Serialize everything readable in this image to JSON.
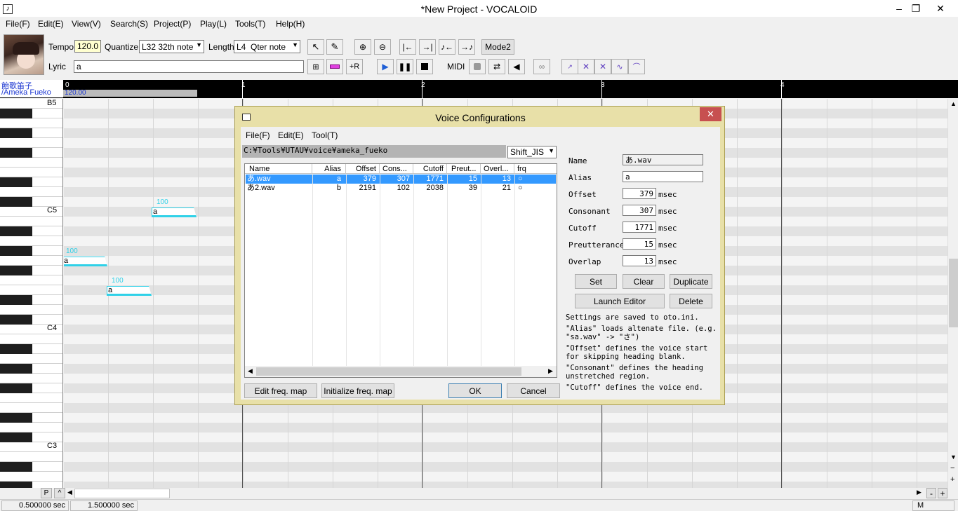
{
  "window": {
    "title": "*New Project - VOCALOID",
    "minimize": "–",
    "restore": "❐",
    "close": "✕"
  },
  "menu": [
    "File(F)",
    "Edit(E)",
    "View(V)",
    "Search(S)",
    "Project(P)",
    "Play(L)",
    "Tools(T)",
    "Help(H)"
  ],
  "toolbar": {
    "tempo_label": "Tempo",
    "tempo_value": "120.0",
    "quantize_label": "Quantize",
    "quantize_value": "L32 32th note",
    "length_label": "Length",
    "length_value": "L4  Qter note",
    "lyric_label": "Lyric",
    "lyric_value": "a",
    "mode_button": "Mode2",
    "midi_label": "MIDI",
    "icons": [
      "arrow-icon",
      "pencil-icon",
      "zoom-in-icon",
      "zoom-out-icon"
    ]
  },
  "track": {
    "singer_jp": "飴歌笛子",
    "singer_en": "/Ameka Fueko",
    "tempo_marker": "120.00"
  },
  "ruler": {
    "measures": [
      "0",
      "1",
      "2",
      "3",
      "4"
    ]
  },
  "piano": {
    "labels": [
      "B5",
      "C5",
      "C4",
      "C3"
    ]
  },
  "notes": [
    {
      "lyric": "a",
      "velocity": "100"
    },
    {
      "lyric": "a",
      "velocity": "100"
    },
    {
      "lyric": "a",
      "velocity": "100"
    }
  ],
  "bottom": {
    "p_button": "P",
    "caret": "^",
    "minus": "-",
    "plus": "+",
    "m_label": "M"
  },
  "status": {
    "left": "0.500000 sec",
    "right": "1.500000 sec"
  },
  "dialog": {
    "title": "Voice Configurations",
    "close": "✕",
    "menu": [
      "File(F)",
      "Edit(E)",
      "Tool(T)"
    ],
    "path": "C:¥Tools¥UTAU¥voice¥ameka_fueko",
    "encoding": "Shift_JIS",
    "columns": [
      "Name",
      "Alias",
      "Offset",
      "Cons...",
      "Cutoff",
      "Preut...",
      "Overl...",
      "frq"
    ],
    "rows": [
      {
        "name": "あ.wav",
        "alias": "a",
        "offset": "379",
        "consonant": "307",
        "cutoff": "1771",
        "preutterance": "15",
        "overlap": "13",
        "frq": "○"
      },
      {
        "name": "あ2.wav",
        "alias": "b",
        "offset": "2191",
        "consonant": "102",
        "cutoff": "2038",
        "preutterance": "39",
        "overlap": "21",
        "frq": "○"
      }
    ],
    "fields": {
      "name_label": "Name",
      "name_value": "あ.wav",
      "alias_label": "Alias",
      "alias_value": "a",
      "offset_label": "Offset",
      "offset_value": "379",
      "consonant_label": "Consonant",
      "consonant_value": "307",
      "cutoff_label": "Cutoff",
      "cutoff_value": "1771",
      "preutterance_label": "Preutterance",
      "preutterance_value": "15",
      "overlap_label": "Overlap",
      "overlap_value": "13",
      "unit": "msec"
    },
    "buttons": {
      "set": "Set",
      "clear": "Clear",
      "duplicate": "Duplicate",
      "launch_editor": "Launch Editor",
      "delete": "Delete",
      "edit_freq": "Edit freq. map",
      "init_freq": "Initialize freq. map",
      "ok": "OK",
      "cancel": "Cancel"
    },
    "help": [
      "Settings are saved to oto.ini.",
      "\"Alias\" loads altenate file. (e.g.",
      "\"sa.wav\" -> \"さ\")",
      "\"Offset\" defines the voice start",
      "for skipping heading blank.",
      "\"Consonant\" defines the heading",
      "unstretched region.",
      "\"Cutoff\" defines the voice end."
    ]
  }
}
